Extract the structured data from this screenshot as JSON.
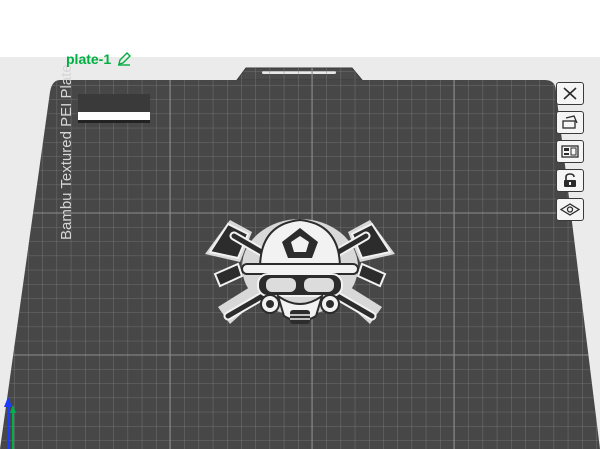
{
  "plate": {
    "name": "plate-1",
    "bed_label": "Bambu Textured PEI Plate"
  },
  "toolbar": {
    "buttons": [
      {
        "icon": "close-icon"
      },
      {
        "icon": "auto-orient-icon"
      },
      {
        "icon": "arrange-icon"
      },
      {
        "icon": "lock-icon"
      },
      {
        "icon": "eye-icon"
      }
    ]
  },
  "colors": {
    "accent": "#00ae42",
    "bed": "#474747",
    "grid": "#7a7a7a",
    "viewport_bg": "#ebebeb"
  },
  "model": {
    "name": "firefighter helmet with axes emblem"
  }
}
